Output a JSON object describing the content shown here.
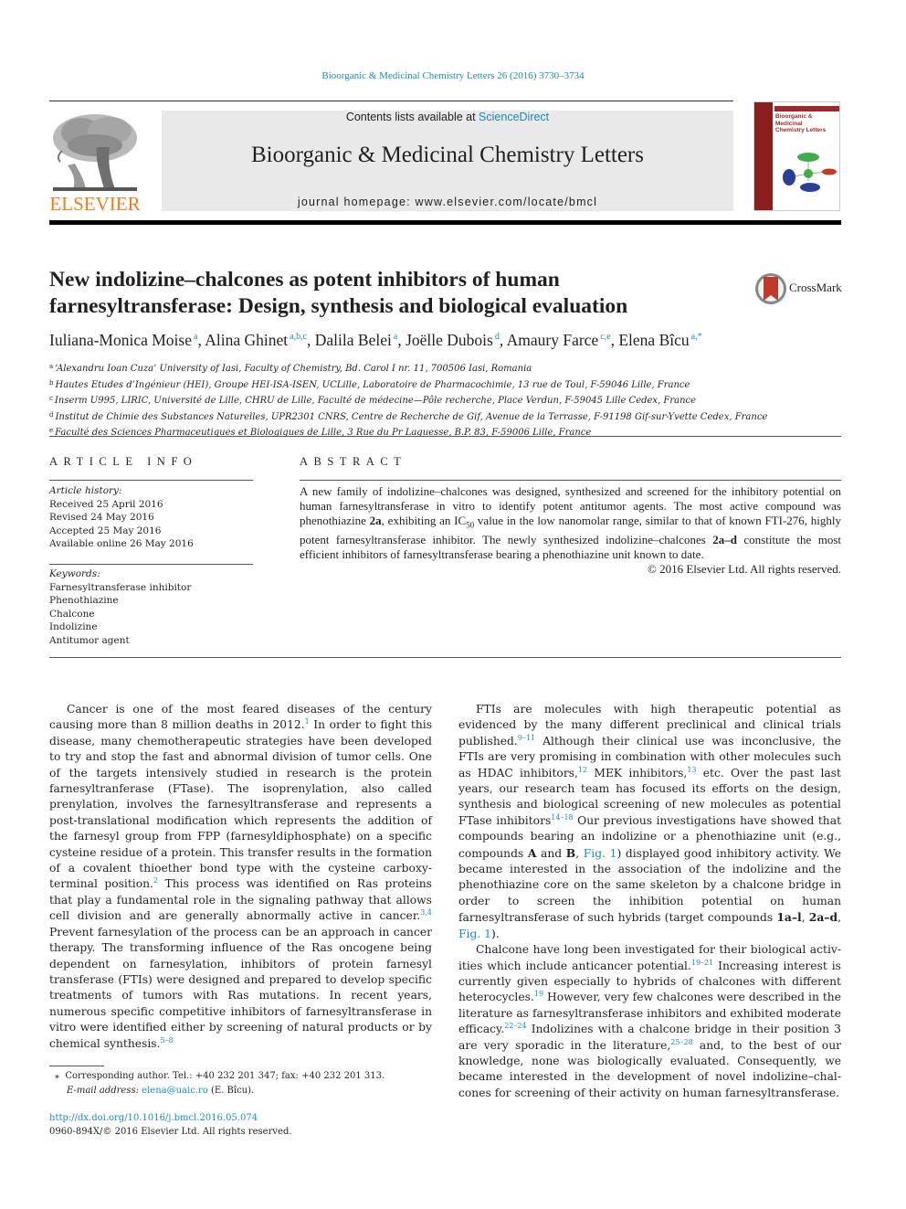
{
  "running_head": "Bioorganic & Medicinal Chemistry Letters 26 (2016) 3730–3734",
  "publisher": {
    "logo_icon": "elsevier-tree-icon",
    "wordmark": "ELSEVIER",
    "brand_color": "#f07d1b"
  },
  "banner": {
    "contents_prefix": "Contents lists available at ",
    "contents_link": "ScienceDirect",
    "journal_title": "Bioorganic & Medicinal Chemistry Letters",
    "homepage_prefix": "journal homepage: ",
    "homepage_url": "www.elsevier.com/locate/bmcl"
  },
  "cover": {
    "icon": "journal-cover-thumbnail",
    "title_line1": "Bioorganic & Medicinal",
    "title_line2": "Chemistry Letters"
  },
  "article": {
    "title_line1": "New indolizine–chalcones as potent inhibitors of human",
    "title_line2": "farnesyltransferase: Design, synthesis and biological evaluation",
    "crossmark_label": "CrossMark",
    "authors": [
      {
        "name": "Iuliana-Monica Moise",
        "aff": "a"
      },
      {
        "name": "Alina Ghinet",
        "aff": "a,b,c"
      },
      {
        "name": "Dalila Belei",
        "aff": "a"
      },
      {
        "name": "Joëlle Dubois",
        "aff": "d"
      },
      {
        "name": "Amaury Farce",
        "aff": "c,e"
      },
      {
        "name": "Elena Bîcu",
        "aff": "a,*"
      }
    ],
    "affiliations": [
      {
        "key": "a",
        "text": "‘Alexandru Ioan Cuza’ University of Iasi, Faculty of Chemistry, Bd. Carol I nr. 11, 700506 Iasi, Romania"
      },
      {
        "key": "b",
        "text": "Hautes Etudes d’Ingénieur (HEI), Groupe HEI-ISA-ISEN, UCLille, Laboratoire de Pharmacochimie, 13 rue de Toul, F-59046 Lille, France"
      },
      {
        "key": "c",
        "text": "Inserm U995, LIRIC, Université de Lille, CHRU de Lille, Faculté de médecine—Pôle recherche, Place Verdun, F-59045 Lille Cedex, France"
      },
      {
        "key": "d",
        "text": "Institut de Chimie des Substances Naturelles, UPR2301 CNRS, Centre de Recherche de Gif, Avenue de la Terrasse, F-91198 Gif-sur-Yvette Cedex, France"
      },
      {
        "key": "e",
        "text": "Faculté des Sciences Pharmaceutiques et Biologiques de Lille, 3 Rue du Pr Laguesse, B.P. 83, F-59006 Lille, France"
      }
    ]
  },
  "article_info": {
    "heading": "ARTICLE INFO",
    "history_label": "Article history:",
    "history": [
      "Received 25 April 2016",
      "Revised 24 May 2016",
      "Accepted 25 May 2016",
      "Available online 26 May 2016"
    ],
    "keywords_label": "Keywords:",
    "keywords": [
      "Farnesyltransferase inhibitor",
      "Phenothiazine",
      "Chalcone",
      "Indolizine",
      "Antitumor agent"
    ]
  },
  "abstract": {
    "heading": "ABSTRACT",
    "p1": "A new family of indolizine–chalcones was designed, synthesized and screened for the inhibitory potential on human farnesyltransferase in vitro to identify potent antitumor agents. The most active compound was phenothiazine ",
    "b1": "2a",
    "p2": ", exhibiting an IC",
    "sub": "50",
    "p3": " value in the low nanomolar range, similar to that of known FTI-276, highly potent farnesyltransferase inhibitor. The newly synthesized indolizine–chalcones ",
    "b2": "2a–d",
    "p4": " constitute the most efficient inhibitors of farnesyltransferase bearing a phenothiazine unit known to date.",
    "copyright": "© 2016 Elsevier Ltd. All rights reserved."
  },
  "body": {
    "left": {
      "s1": "Cancer is one of the most feared diseases of the century causing more than 8 million deaths in 2012.",
      "r1": "1",
      "s2": " In order to fight this disease, many chemotherapeutic strategies have been developed to try and stop the fast and abnormal division of tumor cells. One of the tar­gets intensively studied in research is the protein farnesyltran­ferase (FTase). The isoprenylation, also called prenylation, involves the farnesyltransferase and represents a post-transla­tional modification which represents the addition of the farnesyl group from FPP (farnesyldiphosphate) on a specific cysteine resi­due of a protein. This transfer results in the formation of a covalent thioether bond type with the cysteine carboxy-terminal position.",
      "r2": "2",
      "s3": " This process was identified on Ras proteins that play a fundamen­tal role in the signaling pathway that allows cell division and are generally abnormally active in cancer.",
      "r3": "3,4",
      "s4": " Prevent farnesylation of the process can be an approach in cancer therapy. The transform­ing influence of the Ras oncogene being dependent on farnesyla­tion, inhibitors of protein farnesyl transferase (FTIs) were designed and prepared to develop specific treatments of tumors with Ras mutations. In recent years, numerous specific competitive inhibitors of farnesyltransferase in vitro were identified either by screening of natural products or by chemical synthesis.",
      "r4": "5–8"
    },
    "right": {
      "p1_s1": "FTIs are molecules with high therapeutic potential as evidenced by the many different preclinical and clinical trials published.",
      "p1_r1": "9–11",
      "p1_s2": " Although their clinical use was inconclusive, the FTIs are very promising in combination with other molecules such as HDAC inhibitors,",
      "p1_r2": "12",
      "p1_s3": " MEK inhibitors,",
      "p1_r3": "13",
      "p1_s4": " etc. Over the past last years, our research team has focused its efforts on the design, synthesis and biological screening of new molecules as potential FTase inhibi­tors",
      "p1_r4": "14–18",
      "p1_s5": " Our previous investigations have showed that compounds bearing an indolizine or a phenothiazine unit (e.g., compounds ",
      "p1_bA": "A",
      "p1_s6": " and ",
      "p1_bB": "B",
      "p1_s7": ", ",
      "p1_fig1": "Fig. 1",
      "p1_s8": ") displayed good inhibitory activity. We became inter­ested in the association of the indolizine and the phenothiazine core on the same skeleton by a chalcone bridge in order to screen the inhibition potential on human farnesyltransferase of such hybrids (target compounds ",
      "p1_b1": "1a–l",
      "p1_s9": ", ",
      "p1_b2": "2a–d",
      "p1_s10": ", ",
      "p1_fig2": "Fig. 1",
      "p1_s11": ").",
      "p2_s1": "Chalcone have long been investigated for their biological activ­ities which include anticancer potential.",
      "p2_r1": "19–21",
      "p2_s2": " Increasing interest is currently given especially to hybrids of chalcones with different heterocycles.",
      "p2_r2": "19",
      "p2_s3": " However, very few chalcones were described in the literature as farnesyltransferase inhibitors and exhibited mod­erate efficacy.",
      "p2_r3": "22–24",
      "p2_s4": " Indolizines with a chalcone bridge in their posi­tion 3 are very sporadic in the literature,",
      "p2_r4": "25–28",
      "p2_s5": " and, to the best of our knowledge, none was biologically evaluated. Consequently, we became interested in the development of novel indolizine–chal­cones for screening of their activity on human farnesyltransferase."
    }
  },
  "footnote": {
    "marker": "⁎",
    "line1": "Corresponding author. Tel.: +40 232 201 347; fax: +40 232 201 313.",
    "email_label": "E-mail address: ",
    "email": "elena@uaic.ro",
    "email_suffix": " (E. Bîcu)."
  },
  "doi": {
    "url": "http://dx.doi.org/10.1016/j.bmcl.2016.05.074",
    "issn_line": "0960-894X/© 2016 Elsevier Ltd. All rights reserved."
  },
  "colors": {
    "link": "#1a8bb8",
    "banner_bg": "#e9e9e9",
    "cover_spine": "#8b1e1e",
    "crossmark_red": "#c0392b"
  }
}
